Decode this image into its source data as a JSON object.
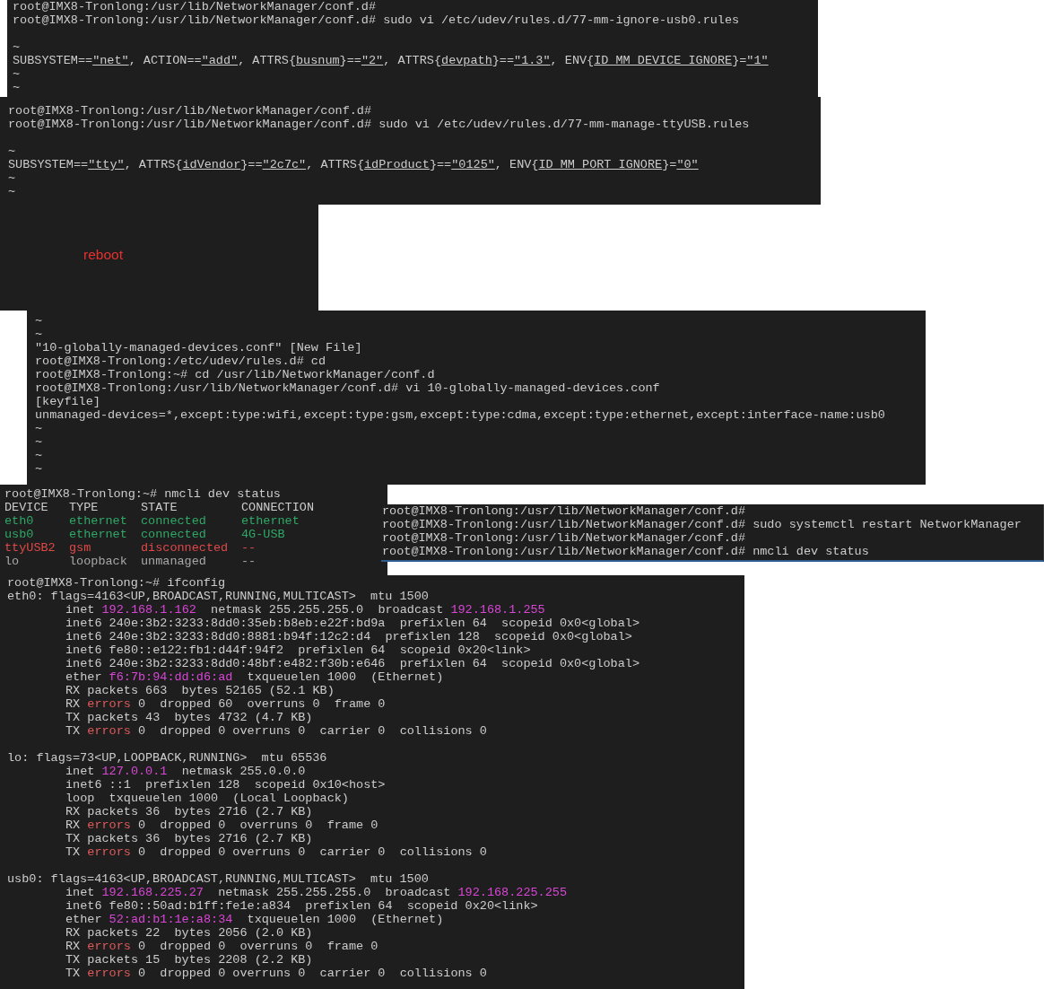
{
  "panels": [
    {
      "kind": "terminal",
      "lines": [
        {
          "kind": "text",
          "segments": [
            {
              "text": "root@IMX8-Tronlong:/usr/lib/NetworkManager/conf.d#",
              "kind": "plain"
            }
          ]
        },
        {
          "kind": "text",
          "segments": [
            {
              "text": "root@IMX8-Tronlong:/usr/lib/NetworkManager/conf.d# sudo vi /etc/udev/rules.d/77-mm-ignore-usb0.rules",
              "kind": "plain"
            }
          ]
        },
        {
          "kind": "blank"
        },
        {
          "kind": "text",
          "segments": [
            {
              "text": "~",
              "kind": "plain"
            }
          ]
        },
        {
          "kind": "text",
          "segments": [
            {
              "text": "SUBSYSTEM==",
              "kind": "plain"
            },
            {
              "text": "\"net\"",
              "kind": "underline"
            },
            {
              "text": ", ACTION==",
              "kind": "plain"
            },
            {
              "text": "\"add\"",
              "kind": "underline"
            },
            {
              "text": ", ATTRS{",
              "kind": "plain"
            },
            {
              "text": "busnum",
              "kind": "underline"
            },
            {
              "text": "}==",
              "kind": "plain"
            },
            {
              "text": "\"2\"",
              "kind": "underline"
            },
            {
              "text": ", ATTRS{",
              "kind": "plain"
            },
            {
              "text": "devpath",
              "kind": "underline"
            },
            {
              "text": "}==",
              "kind": "plain"
            },
            {
              "text": "\"1.3\"",
              "kind": "underline"
            },
            {
              "text": ", ENV{",
              "kind": "plain"
            },
            {
              "text": "ID_MM_DEVICE_IGNORE",
              "kind": "underline"
            },
            {
              "text": "}=",
              "kind": "plain"
            },
            {
              "text": "\"1\"",
              "kind": "underline"
            }
          ]
        },
        {
          "kind": "text",
          "segments": [
            {
              "text": "~",
              "kind": "plain"
            }
          ]
        },
        {
          "kind": "text",
          "segments": [
            {
              "text": "~",
              "kind": "plain"
            }
          ]
        }
      ]
    },
    {
      "kind": "terminal",
      "lines": [
        {
          "kind": "text",
          "segments": [
            {
              "text": "root@IMX8-Tronlong:/usr/lib/NetworkManager/conf.d#",
              "kind": "plain"
            }
          ]
        },
        {
          "kind": "text",
          "segments": [
            {
              "text": "root@IMX8-Tronlong:/usr/lib/NetworkManager/conf.d# sudo vi /etc/udev/rules.d/77-mm-manage-ttyUSB.rules",
              "kind": "plain"
            }
          ]
        },
        {
          "kind": "blank"
        },
        {
          "kind": "text",
          "segments": [
            {
              "text": "~",
              "kind": "plain"
            }
          ]
        },
        {
          "kind": "text",
          "segments": [
            {
              "text": "SUBSYSTEM==",
              "kind": "plain"
            },
            {
              "text": "\"tty\"",
              "kind": "underline"
            },
            {
              "text": ", ATTRS{",
              "kind": "plain"
            },
            {
              "text": "idVendor",
              "kind": "underline"
            },
            {
              "text": "}==",
              "kind": "plain"
            },
            {
              "text": "\"2c7c\"",
              "kind": "underline"
            },
            {
              "text": ", ATTRS{",
              "kind": "plain"
            },
            {
              "text": "idProduct",
              "kind": "underline"
            },
            {
              "text": "}==",
              "kind": "plain"
            },
            {
              "text": "\"0125\"",
              "kind": "underline"
            },
            {
              "text": ", ENV{",
              "kind": "plain"
            },
            {
              "text": "ID_MM_PORT_IGNORE",
              "kind": "underline"
            },
            {
              "text": "}=",
              "kind": "plain"
            },
            {
              "text": "\"0\"",
              "kind": "underline"
            }
          ]
        },
        {
          "kind": "text",
          "segments": [
            {
              "text": "~",
              "kind": "plain"
            }
          ]
        },
        {
          "kind": "text",
          "segments": [
            {
              "text": "~",
              "kind": "plain"
            }
          ]
        }
      ]
    },
    {
      "kind": "note",
      "text": "reboot"
    },
    {
      "kind": "terminal",
      "lines": [
        {
          "kind": "text",
          "segments": [
            {
              "text": "~",
              "kind": "plain"
            }
          ]
        },
        {
          "kind": "text",
          "segments": [
            {
              "text": "~",
              "kind": "plain"
            }
          ]
        },
        {
          "kind": "text",
          "segments": [
            {
              "text": "\"10-globally-managed-devices.conf\" [New File]",
              "kind": "plain"
            }
          ]
        },
        {
          "kind": "text",
          "segments": [
            {
              "text": "root@IMX8-Tronlong:/etc/udev/rules.d# cd",
              "kind": "plain"
            }
          ]
        },
        {
          "kind": "text",
          "segments": [
            {
              "text": "root@IMX8-Tronlong:~# cd /usr/lib/NetworkManager/conf.d",
              "kind": "plain"
            }
          ]
        },
        {
          "kind": "text",
          "segments": [
            {
              "text": "root@IMX8-Tronlong:/usr/lib/NetworkManager/conf.d# vi 10-globally-managed-devices.conf",
              "kind": "plain"
            }
          ]
        },
        {
          "kind": "text",
          "segments": [
            {
              "text": "[keyfile]",
              "kind": "plain"
            }
          ]
        },
        {
          "kind": "text",
          "segments": [
            {
              "text": "unmanaged-devices=*,except:type:wifi,except:type:gsm,except:type:cdma,except:type:ethernet,except:interface-name:usb0",
              "kind": "plain"
            }
          ]
        },
        {
          "kind": "text",
          "segments": [
            {
              "text": "~",
              "kind": "plain"
            }
          ]
        },
        {
          "kind": "text",
          "segments": [
            {
              "text": "~",
              "kind": "plain"
            }
          ]
        },
        {
          "kind": "text",
          "segments": [
            {
              "text": "~",
              "kind": "plain"
            }
          ]
        },
        {
          "kind": "text",
          "segments": [
            {
              "text": "~",
              "kind": "plain"
            }
          ]
        }
      ]
    },
    {
      "kind": "device_status",
      "prompt": "root@IMX8-Tronlong:~# nmcli dev status",
      "columns": [
        "DEVICE",
        "TYPE",
        "STATE",
        "CONNECTION"
      ],
      "rows": [
        {
          "kind": "connected",
          "cells": [
            "eth0",
            "ethernet",
            "connected",
            "ethernet"
          ]
        },
        {
          "kind": "connected",
          "cells": [
            "usb0",
            "ethernet",
            "connected",
            "4G-USB"
          ]
        },
        {
          "kind": "disconnected",
          "cells": [
            "ttyUSB2",
            "gsm",
            "disconnected",
            "--"
          ]
        },
        {
          "kind": "unmanaged",
          "cells": [
            "lo",
            "loopback",
            "unmanaged",
            "--"
          ]
        }
      ]
    },
    {
      "kind": "terminal",
      "lines": [
        {
          "kind": "text",
          "segments": [
            {
              "text": "root@IMX8-Tronlong:/usr/lib/NetworkManager/conf.d#",
              "kind": "plain"
            }
          ]
        },
        {
          "kind": "text",
          "segments": [
            {
              "text": "root@IMX8-Tronlong:/usr/lib/NetworkManager/conf.d# sudo systemctl restart NetworkManager",
              "kind": "plain"
            }
          ]
        },
        {
          "kind": "text",
          "segments": [
            {
              "text": "root@IMX8-Tronlong:/usr/lib/NetworkManager/conf.d#",
              "kind": "plain"
            }
          ]
        },
        {
          "kind": "text",
          "segments": [
            {
              "text": "root@IMX8-Tronlong:/usr/lib/NetworkManager/conf.d# nmcli dev status",
              "kind": "plain"
            }
          ]
        }
      ]
    },
    {
      "kind": "ifconfig",
      "prompt": "root@IMX8-Tronlong:~# ifconfig",
      "interfaces": [
        {
          "header": "eth0: flags=4163<UP,BROADCAST,RUNNING,MULTICAST>  mtu 1500",
          "details": [
            [
              {
                "text": "inet ",
                "kind": "plain"
              },
              {
                "text": "192.168.1.162",
                "kind": "address"
              },
              {
                "text": "  netmask 255.255.255.0  broadcast ",
                "kind": "plain"
              },
              {
                "text": "192.168.1.255",
                "kind": "address"
              }
            ],
            [
              {
                "text": "inet6 240e:3b2:3233:8dd0:35eb:b8eb:e22f:bd9a  prefixlen 64  scopeid 0x0<global>",
                "kind": "plain"
              }
            ],
            [
              {
                "text": "inet6 240e:3b2:3233:8dd0:8881:b94f:12c2:d4  prefixlen 128  scopeid 0x0<global>",
                "kind": "plain"
              }
            ],
            [
              {
                "text": "inet6 fe80::e122:fb1:d44f:94f2  prefixlen 64  scopeid 0x20<link>",
                "kind": "plain"
              }
            ],
            [
              {
                "text": "inet6 240e:3b2:3233:8dd0:48bf:e482:f30b:e646  prefixlen 64  scopeid 0x0<global>",
                "kind": "plain"
              }
            ],
            [
              {
                "text": "ether ",
                "kind": "plain"
              },
              {
                "text": "f6:7b:94:dd:d6:ad",
                "kind": "address"
              },
              {
                "text": "  txqueuelen 1000  (Ethernet)",
                "kind": "plain"
              }
            ],
            [
              {
                "text": "RX packets 663  bytes 52165 (52.1 KB)",
                "kind": "plain"
              }
            ],
            [
              {
                "text": "RX ",
                "kind": "plain"
              },
              {
                "text": "errors",
                "kind": "error"
              },
              {
                "text": " 0  dropped 60  overruns 0  frame 0",
                "kind": "plain"
              }
            ],
            [
              {
                "text": "TX packets 43  bytes 4732 (4.7 KB)",
                "kind": "plain"
              }
            ],
            [
              {
                "text": "TX ",
                "kind": "plain"
              },
              {
                "text": "errors",
                "kind": "error"
              },
              {
                "text": " 0  dropped 0 overruns 0  carrier 0  collisions 0",
                "kind": "plain"
              }
            ]
          ]
        },
        {
          "header": "lo: flags=73<UP,LOOPBACK,RUNNING>  mtu 65536",
          "details": [
            [
              {
                "text": "inet ",
                "kind": "plain"
              },
              {
                "text": "127.0.0.1",
                "kind": "address"
              },
              {
                "text": "  netmask 255.0.0.0",
                "kind": "plain"
              }
            ],
            [
              {
                "text": "inet6 ::1  prefixlen 128  scopeid 0x10<host>",
                "kind": "plain"
              }
            ],
            [
              {
                "text": "loop  txqueuelen 1000  (Local Loopback)",
                "kind": "plain"
              }
            ],
            [
              {
                "text": "RX packets 36  bytes 2716 (2.7 KB)",
                "kind": "plain"
              }
            ],
            [
              {
                "text": "RX ",
                "kind": "plain"
              },
              {
                "text": "errors",
                "kind": "error"
              },
              {
                "text": " 0  dropped 0  overruns 0  frame 0",
                "kind": "plain"
              }
            ],
            [
              {
                "text": "TX packets 36  bytes 2716 (2.7 KB)",
                "kind": "plain"
              }
            ],
            [
              {
                "text": "TX ",
                "kind": "plain"
              },
              {
                "text": "errors",
                "kind": "error"
              },
              {
                "text": " 0  dropped 0 overruns 0  carrier 0  collisions 0",
                "kind": "plain"
              }
            ]
          ]
        },
        {
          "header": "usb0: flags=4163<UP,BROADCAST,RUNNING,MULTICAST>  mtu 1500",
          "details": [
            [
              {
                "text": "inet ",
                "kind": "plain"
              },
              {
                "text": "192.168.225.27",
                "kind": "address"
              },
              {
                "text": "  netmask 255.255.255.0  broadcast ",
                "kind": "plain"
              },
              {
                "text": "192.168.225.255",
                "kind": "address"
              }
            ],
            [
              {
                "text": "inet6 fe80::50ad:b1ff:fe1e:a834  prefixlen 64  scopeid 0x20<link>",
                "kind": "plain"
              }
            ],
            [
              {
                "text": "ether ",
                "kind": "plain"
              },
              {
                "text": "52:ad:b1:1e:a8:34",
                "kind": "address"
              },
              {
                "text": "  txqueuelen 1000  (Ethernet)",
                "kind": "plain"
              }
            ],
            [
              {
                "text": "RX packets 22  bytes 2056 (2.0 KB)",
                "kind": "plain"
              }
            ],
            [
              {
                "text": "RX ",
                "kind": "plain"
              },
              {
                "text": "errors",
                "kind": "error"
              },
              {
                "text": " 0  dropped 0  overruns 0  frame 0",
                "kind": "plain"
              }
            ],
            [
              {
                "text": "TX packets 15  bytes 2208 (2.2 KB)",
                "kind": "plain"
              }
            ],
            [
              {
                "text": "TX ",
                "kind": "plain"
              },
              {
                "text": "errors",
                "kind": "error"
              },
              {
                "text": " 0  dropped 0 overruns 0  carrier 0  collisions 0",
                "kind": "plain"
              }
            ]
          ]
        }
      ]
    }
  ]
}
